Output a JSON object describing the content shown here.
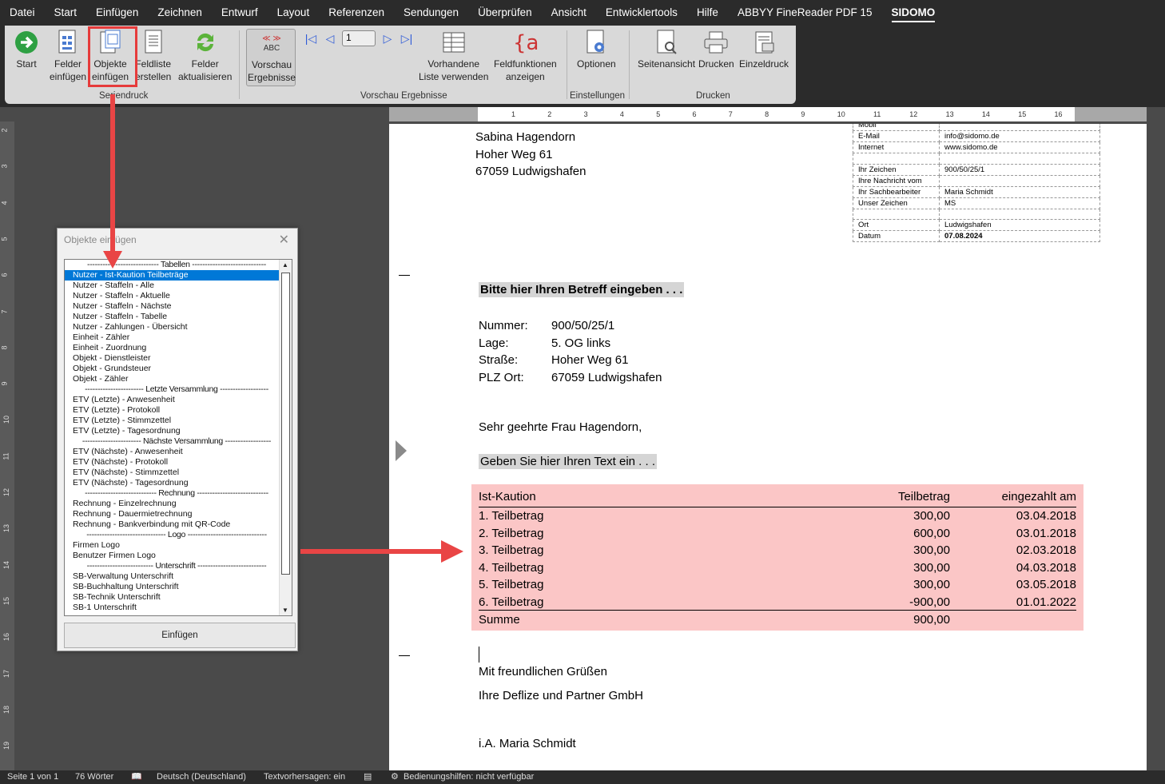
{
  "menu": [
    "Datei",
    "Start",
    "Einfügen",
    "Zeichnen",
    "Entwurf",
    "Layout",
    "Referenzen",
    "Sendungen",
    "Überprüfen",
    "Ansicht",
    "Entwicklertools",
    "Hilfe",
    "ABBYY FineReader PDF 15",
    "SIDOMO"
  ],
  "ribbon": {
    "start": "Start",
    "felder_einfuegen": "Felder\neinfügen",
    "objekte_einfuegen": "Objekte\neinfügen",
    "feldliste": "Feldliste\nerstellen",
    "felder_aktualisieren": "Felder\naktualisieren",
    "vorschau": "Vorschau\nErgebnisse",
    "vorschau_abc": "ABC",
    "page_number": "1",
    "vorhandene_liste": "Vorhandene\nListe verwenden",
    "feldfunktionen": "Feldfunktionen\nanzeigen",
    "optionen": "Optionen",
    "seitenansicht": "Seitenansicht",
    "drucken": "Drucken",
    "einzeldruck": "Einzeldruck",
    "groups": {
      "seriendruck": "Seriendruck",
      "vorschau_ergebnisse": "Vorschau Ergebnisse",
      "einstellungen": "Einstellungen",
      "drucken": "Drucken"
    }
  },
  "ruler_ticks": [
    "1",
    "2",
    "3",
    "4",
    "5",
    "6",
    "7",
    "8",
    "9",
    "10",
    "11",
    "12",
    "13",
    "14",
    "15",
    "16"
  ],
  "vruler_ticks": [
    "2",
    "3",
    "4",
    "5",
    "6",
    "7",
    "8",
    "9",
    "10",
    "11",
    "12",
    "13",
    "14",
    "15",
    "16",
    "17",
    "18",
    "19"
  ],
  "document": {
    "address": [
      "Sabina Hagendorn",
      "Hoher Weg 61",
      "67059 Ludwigshafen"
    ],
    "info": [
      {
        "label": "Mobil",
        "value": ""
      },
      {
        "label": "E-Mail",
        "value": "info@sidomo.de"
      },
      {
        "label": "Internet",
        "value": "www.sidomo.de"
      },
      {
        "label": "",
        "value": ""
      },
      {
        "label": "Ihr Zeichen",
        "value": "900/50/25/1"
      },
      {
        "label": "Ihre Nachricht vom",
        "value": ""
      },
      {
        "label": "Ihr Sachbearbeiter",
        "value": "Maria Schmidt"
      },
      {
        "label": "Unser Zeichen",
        "value": "MS"
      },
      {
        "label": "",
        "value": ""
      },
      {
        "label": "Ort",
        "value": "Ludwigshafen"
      },
      {
        "label": "Datum",
        "value": "07.08.2024"
      }
    ],
    "subject": "Bitte hier Ihren Betreff eingeben . . .",
    "meta": [
      {
        "label": "Nummer:",
        "value": "900/50/25/1"
      },
      {
        "label": "Lage:",
        "value": "5. OG links"
      },
      {
        "label": "Straße:",
        "value": "Hoher Weg 61"
      },
      {
        "label": "PLZ Ort:",
        "value": "67059 Ludwigshafen"
      }
    ],
    "salutation": "Sehr geehrte Frau Hagendorn,",
    "text_placeholder": "Geben Sie hier Ihren Text ein . . .",
    "kaution": {
      "headers": [
        "Ist-Kaution",
        "Teilbetrag",
        "eingezahlt am"
      ],
      "rows": [
        {
          "name": "1. Teilbetrag",
          "amount": "300,00",
          "date": "03.04.2018"
        },
        {
          "name": "2. Teilbetrag",
          "amount": "600,00",
          "date": "03.01.2018"
        },
        {
          "name": "3. Teilbetrag",
          "amount": "300,00",
          "date": "02.03.2018"
        },
        {
          "name": "4. Teilbetrag",
          "amount": "300,00",
          "date": "04.03.2018"
        },
        {
          "name": "5. Teilbetrag",
          "amount": "300,00",
          "date": "03.05.2018"
        },
        {
          "name": "6. Teilbetrag",
          "amount": "-900,00",
          "date": "01.01.2022"
        }
      ],
      "sum_label": "Summe",
      "sum_value": "900,00"
    },
    "closing": "Mit freundlichen Grüßen",
    "company": "Ihre Deflize und Partner GmbH",
    "signature": "i.A. Maria Schmidt"
  },
  "dialog": {
    "title": "Objekte einfügen",
    "items": [
      {
        "text": "---------------------------- Tabellen -----------------------------",
        "hdr": true
      },
      {
        "text": "Nutzer - Ist-Kaution Teilbeträge",
        "sel": true
      },
      {
        "text": "Nutzer - Staffeln - Alle"
      },
      {
        "text": "Nutzer - Staffeln - Aktuelle"
      },
      {
        "text": "Nutzer - Staffeln - Nächste"
      },
      {
        "text": "Nutzer - Staffeln - Tabelle"
      },
      {
        "text": "Nutzer - Zahlungen - Übersicht"
      },
      {
        "text": "Einheit - Zähler"
      },
      {
        "text": "Einheit - Zuordnung"
      },
      {
        "text": "Objekt - Dienstleister"
      },
      {
        "text": "Objekt - Grundsteuer"
      },
      {
        "text": "Objekt - Zähler"
      },
      {
        "text": "----------------------- Letzte Versammlung -------------------",
        "hdr": true
      },
      {
        "text": "ETV (Letzte) - Anwesenheit"
      },
      {
        "text": "ETV (Letzte) - Protokoll"
      },
      {
        "text": "ETV (Letzte) - Stimmzettel"
      },
      {
        "text": "ETV (Letzte) - Tagesordnung"
      },
      {
        "text": "----------------------- Nächste Versammlung ------------------",
        "hdr": true
      },
      {
        "text": "ETV (Nächste) - Anwesenheit"
      },
      {
        "text": "ETV (Nächste) - Protokoll"
      },
      {
        "text": "ETV (Nächste) - Stimmzettel"
      },
      {
        "text": "ETV (Nächste) - Tagesordnung"
      },
      {
        "text": "---------------------------- Rechnung ----------------------------",
        "hdr": true
      },
      {
        "text": "Rechnung - Einzelrechnung"
      },
      {
        "text": "Rechnung - Dauermietrechnung"
      },
      {
        "text": "Rechnung - Bankverbindung mit QR-Code"
      },
      {
        "text": "------------------------------- Logo -------------------------------",
        "hdr": true
      },
      {
        "text": "Firmen Logo"
      },
      {
        "text": "Benutzer Firmen Logo"
      },
      {
        "text": "-------------------------- Unterschrift ---------------------------",
        "hdr": true
      },
      {
        "text": "SB-Verwaltung Unterschrift"
      },
      {
        "text": "SB-Buchhaltung Unterschrift"
      },
      {
        "text": "SB-Technik Unterschrift"
      },
      {
        "text": "SB-1 Unterschrift"
      }
    ],
    "button": "Einfügen"
  },
  "status": {
    "page": "Seite 1 von 1",
    "words": "76 Wörter",
    "language": "Deutsch (Deutschland)",
    "predictions": "Textvorhersagen: ein",
    "accessibility": "Bedienungshilfen: nicht verfügbar"
  }
}
